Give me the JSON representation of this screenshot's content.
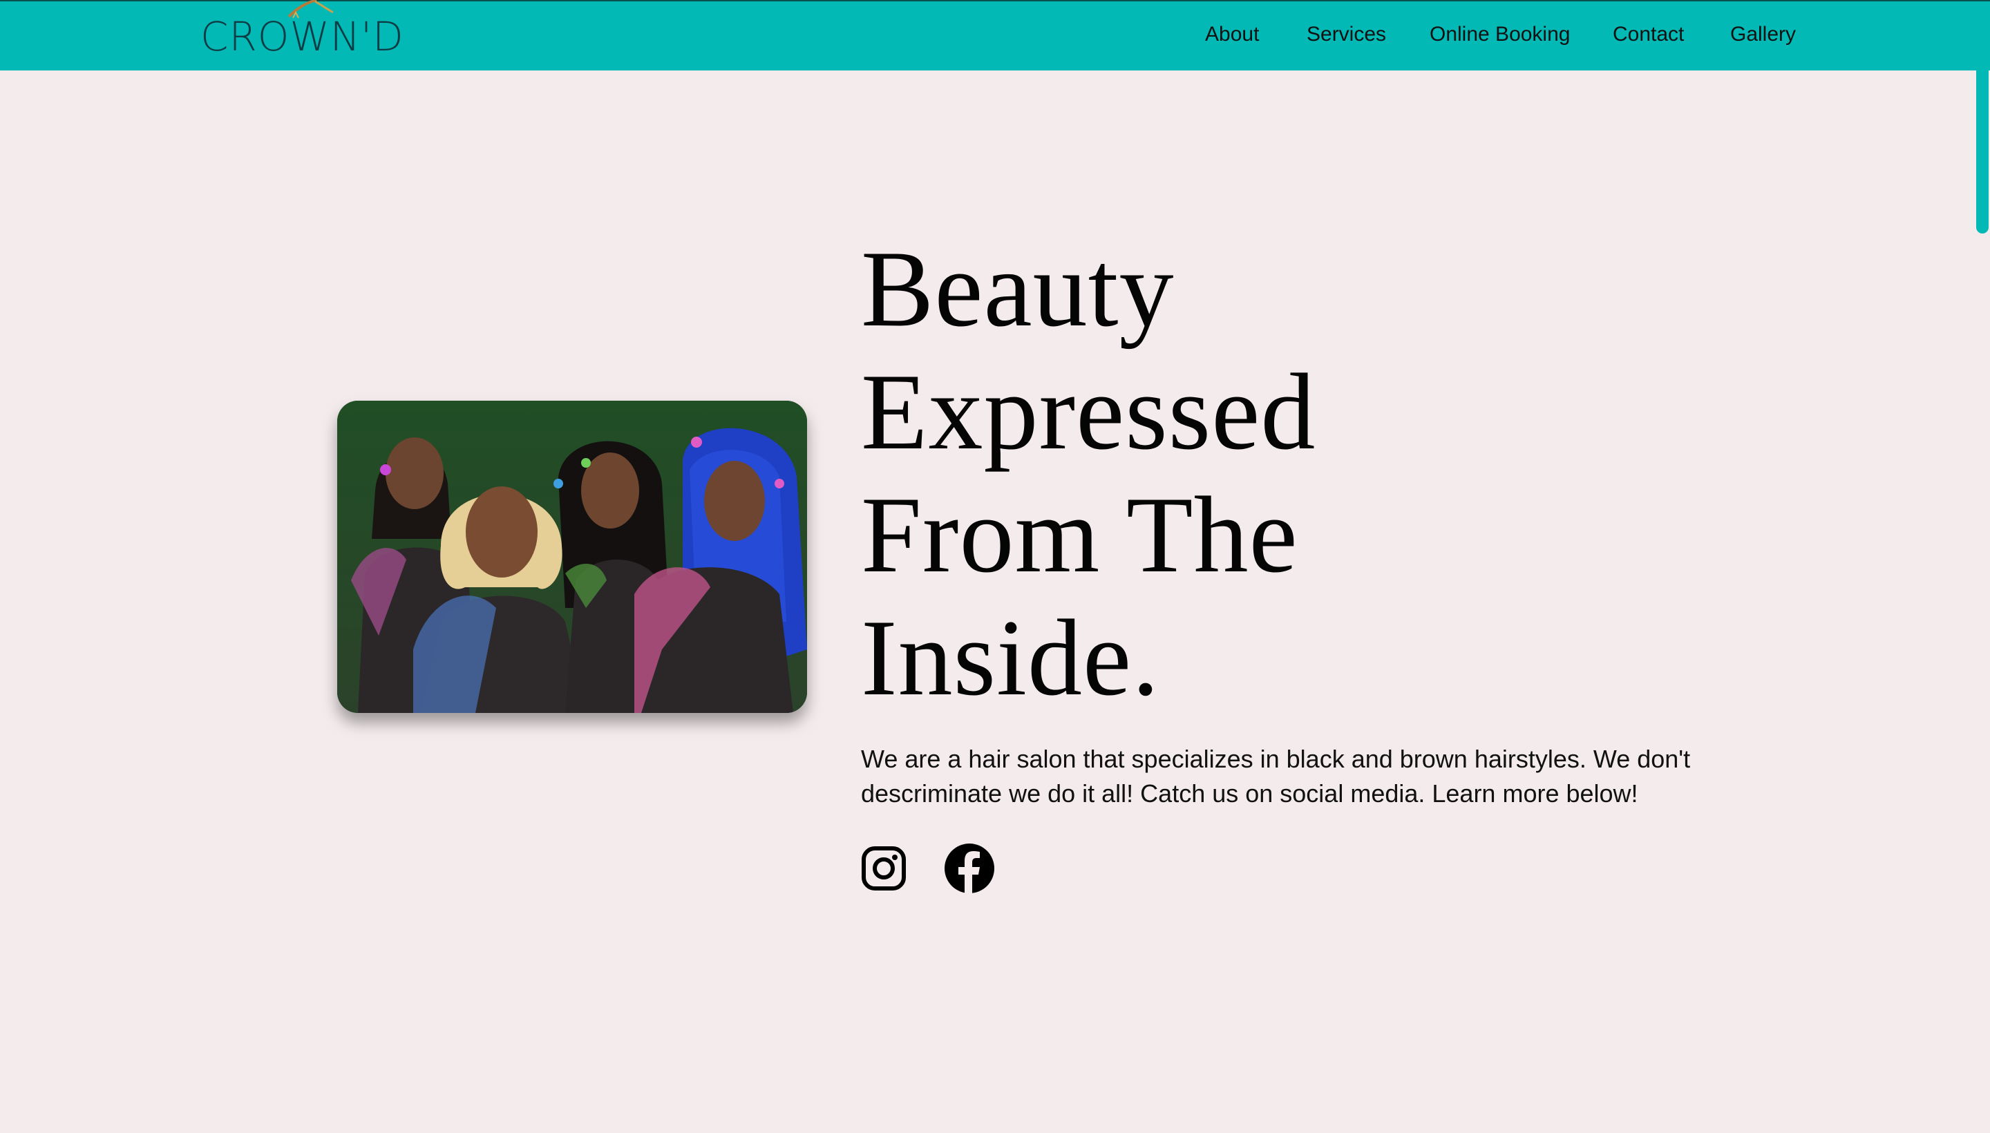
{
  "brand": {
    "logo_text": "CROWN'D",
    "accent_color": "#03b9b5"
  },
  "nav": {
    "items": [
      {
        "label": "About"
      },
      {
        "label": "Services"
      },
      {
        "label": "Online Booking"
      },
      {
        "label": "Contact"
      },
      {
        "label": "Gallery"
      }
    ]
  },
  "hero": {
    "headline_lines": [
      "Beauty",
      "Expressed",
      "From The",
      "Inside."
    ],
    "description": "We are a hair salon that specializes in black and brown hairstyles. We don't descriminate we do it all! Catch us on social media. Learn more below!",
    "image_alt": "Four women with styled hair and glitter body art",
    "social": [
      {
        "name": "Instagram",
        "icon": "instagram-icon"
      },
      {
        "name": "Facebook",
        "icon": "facebook-icon"
      }
    ]
  },
  "colors": {
    "nav_background": "#03b9b5",
    "page_background": "#f3ebec",
    "text": "#050505"
  }
}
